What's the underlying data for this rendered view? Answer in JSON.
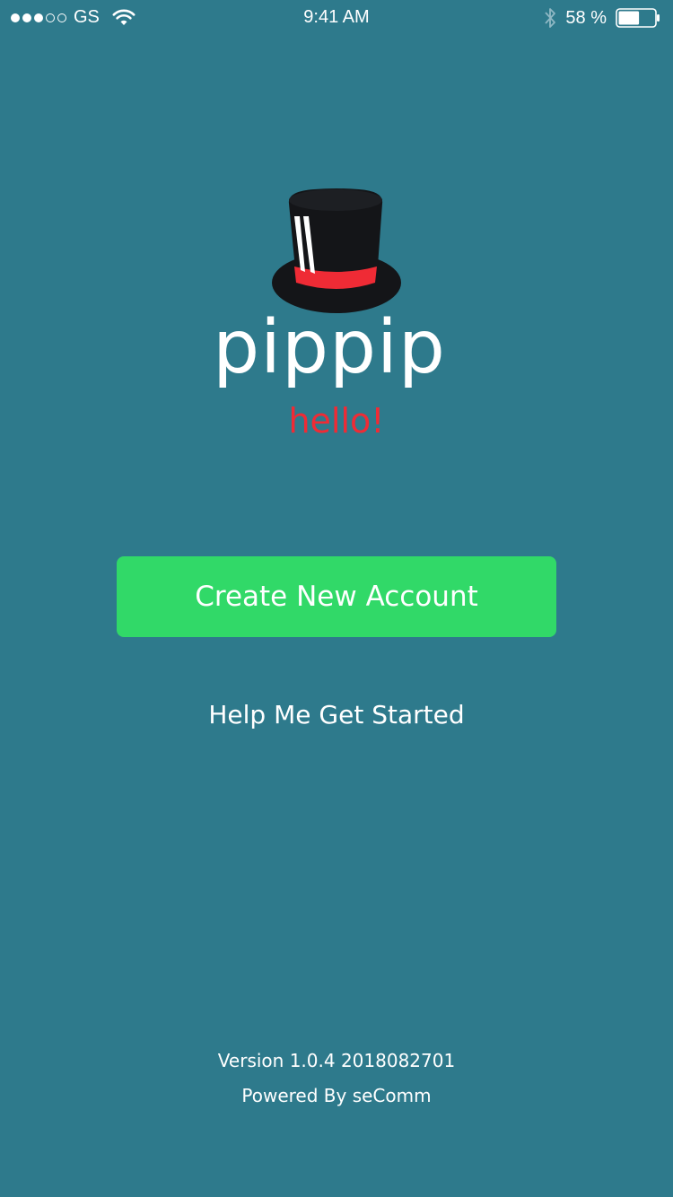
{
  "status_bar": {
    "signal_strength": "3 of 5",
    "carrier": "GS",
    "time": "9:41 AM",
    "battery_percent": "58 %",
    "battery_level": 0.58,
    "icons": [
      "wifi-icon",
      "bluetooth-icon",
      "battery-icon"
    ]
  },
  "logo": {
    "icon": "top-hat-icon",
    "brand": "pippip",
    "greeting": "hello!"
  },
  "actions": {
    "create_account_label": "Create New Account",
    "help_label": "Help Me Get Started"
  },
  "footer": {
    "version": "Version 1.0.4 2018082701",
    "powered_by": "Powered By seComm"
  },
  "colors": {
    "background": "#2e7a8c",
    "primary_button": "#31d968",
    "accent_red": "#ef2b35",
    "hat_black": "#141518",
    "text": "#ffffff"
  }
}
